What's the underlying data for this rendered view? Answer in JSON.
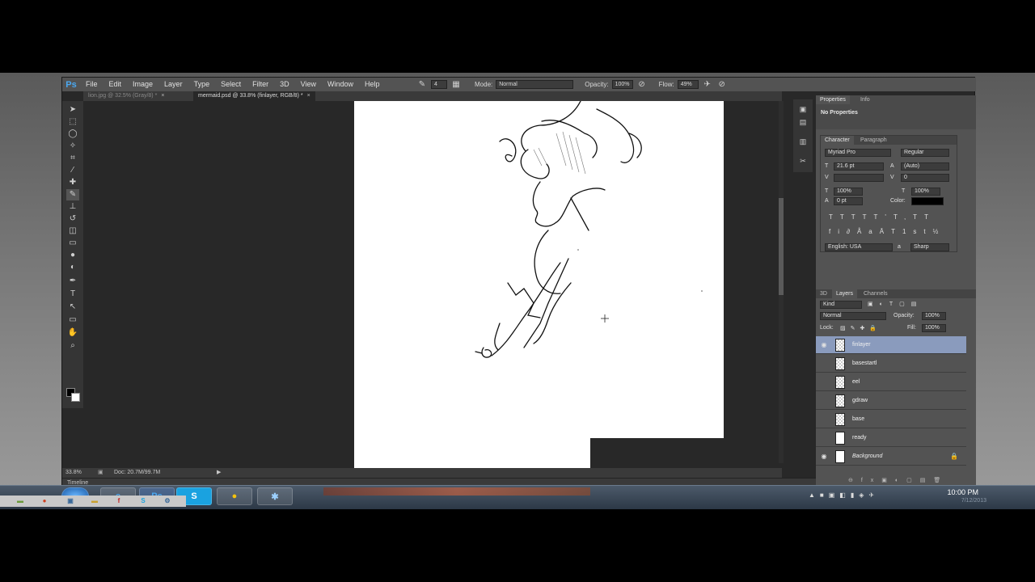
{
  "menubar": {
    "logo": "Ps",
    "items": [
      "File",
      "Edit",
      "Image",
      "Layer",
      "Type",
      "Select",
      "Filter",
      "3D",
      "View",
      "Window",
      "Help"
    ]
  },
  "options": {
    "brush_size": "4",
    "mode_label": "Mode:",
    "mode_value": "Normal",
    "opacity_label": "Opacity:",
    "opacity_value": "100%",
    "flow_label": "Flow:",
    "flow_value": "49%"
  },
  "tabs": [
    {
      "label": "lion.jpg @ 32.5% (Gray/8) *",
      "active": false
    },
    {
      "label": "mermaid.psd @ 33.8% (finlayer, RGB/8) *",
      "active": true
    }
  ],
  "status": {
    "zoom": "33.8%",
    "doc": "Doc: 20.7M/99.7M"
  },
  "timeline": "Timeline",
  "properties": {
    "tabs": [
      "Properties",
      "Info"
    ],
    "content": "No Properties"
  },
  "character": {
    "tabs": [
      "Character",
      "Paragraph"
    ],
    "font_family": "Myriad Pro",
    "font_style": "Regular",
    "size": "21.6 pt",
    "leading": "(Auto)",
    "kerning": "",
    "tracking": "0",
    "vscale": "100%",
    "hscale": "100%",
    "baseline": "0 pt",
    "color_label": "Color:",
    "language": "English: USA",
    "aa_label": "a",
    "antialias": "Sharp"
  },
  "layers": {
    "tabs": [
      "3D",
      "Layers",
      "Channels"
    ],
    "filter": "Kind",
    "blend": "Normal",
    "opacity_label": "Opacity:",
    "opacity": "100%",
    "lock_label": "Lock:",
    "fill_label": "Fill:",
    "fill": "100%",
    "items": [
      {
        "name": "finlayer",
        "visible": true,
        "selected": true
      },
      {
        "name": "basestartl",
        "visible": false,
        "selected": false
      },
      {
        "name": "eel",
        "visible": false,
        "selected": false
      },
      {
        "name": "gdraw",
        "visible": false,
        "selected": false
      },
      {
        "name": "base",
        "visible": false,
        "selected": false
      },
      {
        "name": "ready",
        "visible": false,
        "selected": false
      },
      {
        "name": "Background",
        "visible": true,
        "selected": false
      }
    ]
  },
  "taskbar": {
    "time": "10:00 PM",
    "date": "7/12/2013"
  },
  "colors": {
    "accent": "#8a9bbd",
    "ps_blue": "#4aa8f0"
  }
}
